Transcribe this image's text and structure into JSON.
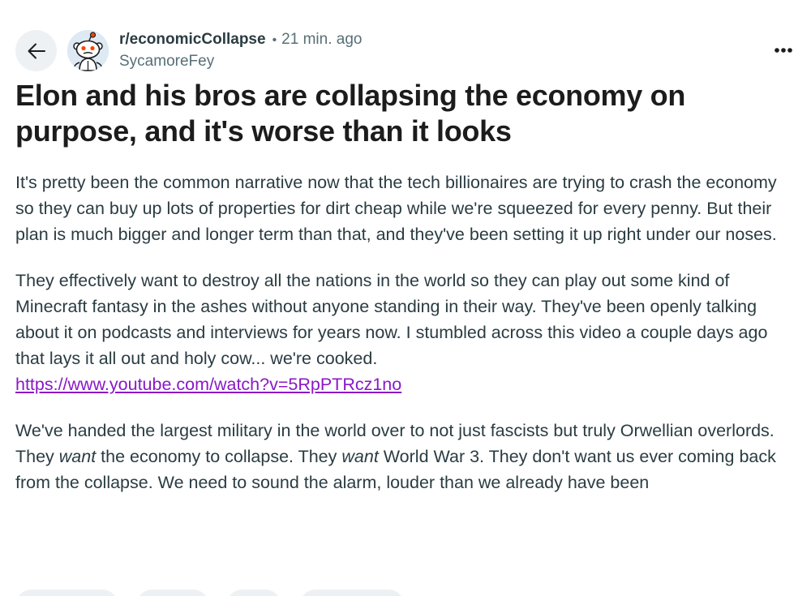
{
  "header": {
    "subreddit": "r/economicCollapse",
    "separator": "•",
    "time": "21 min. ago",
    "username": "SycamoreFey"
  },
  "icons": {
    "back": "arrow-left-icon",
    "avatar": "snoo-avatar-icon",
    "more": "more-horizontal-icon"
  },
  "post": {
    "title": "Elon and his bros are collapsing the economy on purpose, and it's worse than it looks",
    "paragraph1": "It's pretty been the common narrative now that the tech billionaires are trying to crash the economy so they can buy up lots of properties for dirt cheap while we're squeezed for every penny. But their plan is much bigger and longer term than that, and they've been setting it up right under our noses.",
    "paragraph2": "They effectively want to destroy all the nations in the world so they can play out some kind of Minecraft fantasy in the ashes without anyone standing in their way. They've been openly talking about it on podcasts and interviews for years now. I stumbled across this video a couple days ago that lays it all out and holy cow... we're cooked.",
    "link": "https://www.youtube.com/watch?v=5RpPTRcz1no",
    "paragraph3": {
      "part1": "We've handed the largest military in the world over to not just fascists but truly Orwellian overlords. They ",
      "em1": "want",
      "part2": " the economy to collapse. They ",
      "em2": "want",
      "part3": " World War 3. They don't want us ever coming back from the collapse. We need to sound the alarm, louder than we already have been"
    }
  },
  "colors": {
    "link": "#8a18c7",
    "chip_background": "#eef1f4",
    "secondary_text": "#576f76"
  }
}
